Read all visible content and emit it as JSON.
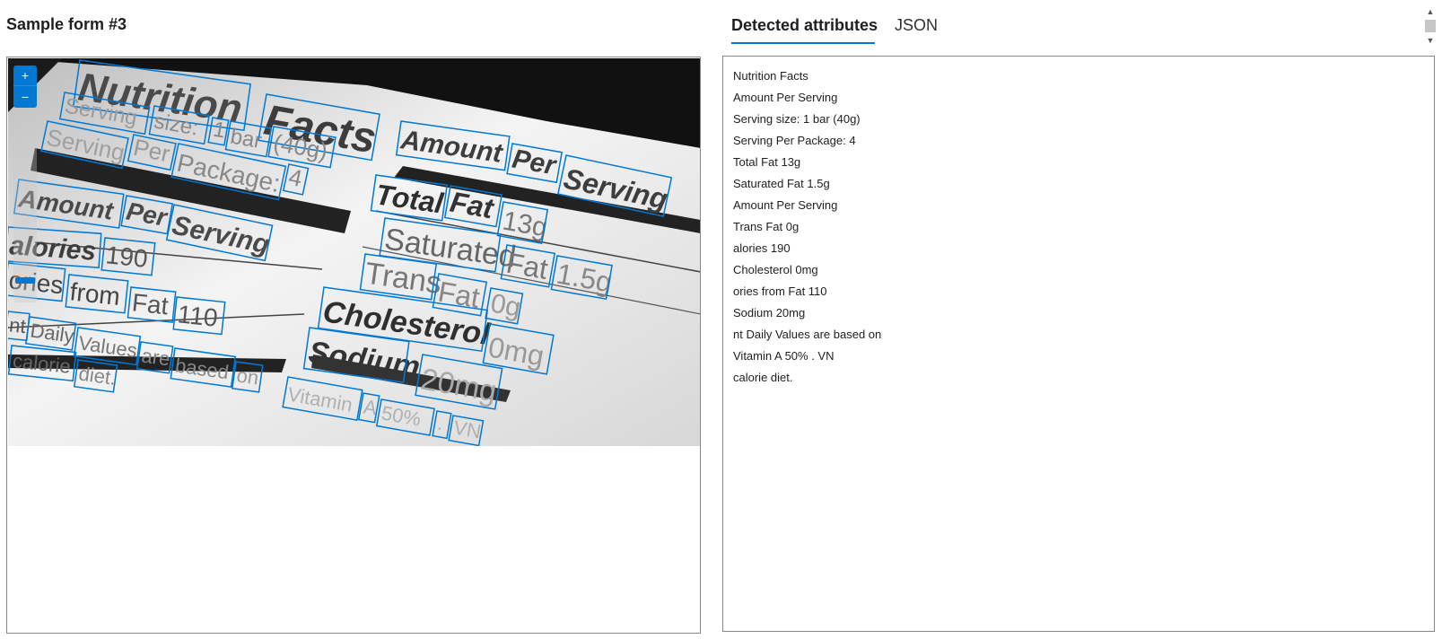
{
  "form": {
    "title": "Sample form #3"
  },
  "image_viewer": {
    "zoom_in_icon": "plus-icon",
    "zoom_out_icon": "minus-icon",
    "image_description_words": [
      "Nutrition",
      "Facts",
      "Serving",
      "size:",
      "1",
      "bar",
      "(40g)",
      "Per",
      "Package:",
      "4",
      "Amount",
      "Total",
      "Fat",
      "13g",
      "alories",
      "190",
      "Saturated",
      "1.5g",
      "ories",
      "from",
      "110",
      "Trans",
      "0g",
      "Cholesterol",
      "0mg",
      "nt",
      "Daily",
      "Values",
      "are",
      "based",
      "on",
      "calorie",
      "diet.",
      "Sodium",
      "20mg",
      "Vitamin",
      "A",
      "50%",
      ".",
      "VN"
    ]
  },
  "tabs": [
    {
      "label": "Detected attributes",
      "active": true
    },
    {
      "label": "JSON",
      "active": false
    }
  ],
  "attributes": [
    "Nutrition Facts",
    "Amount Per Serving",
    "Serving size: 1 bar (40g)",
    "Serving Per Package: 4",
    "Total Fat 13g",
    "Saturated Fat 1.5g",
    "Amount Per Serving",
    "Trans Fat 0g",
    "alories 190",
    "Cholesterol 0mg",
    "ories from Fat 110",
    "Sodium 20mg",
    "nt Daily Values are based on",
    "Vitamin A 50% . VN",
    "calorie diet."
  ],
  "colors": {
    "accent": "#0078d4",
    "border": "#8a8886"
  }
}
